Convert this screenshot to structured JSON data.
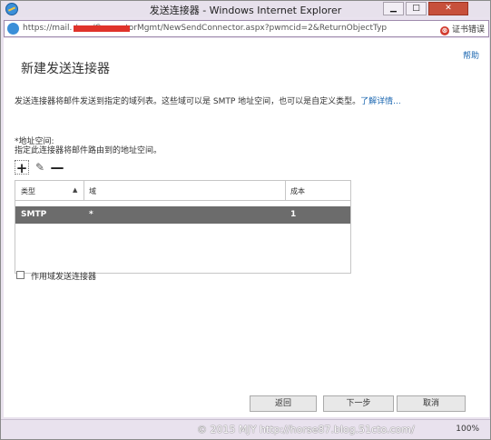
{
  "window": {
    "title": "发送连接器 - Windows Internet Explorer",
    "minimize": "▁",
    "maximize": "□",
    "close": "✕"
  },
  "address_bar": {
    "url": "https://mail.                 /ecp/ConnectorMgmt/NewSendConnector.aspx?pwmcid=2&ReturnObjectTyp",
    "cert_error_icon": "⊗",
    "cert_error": "证书错误"
  },
  "page": {
    "help": "帮助",
    "title": "新建发送连接器",
    "description": "发送连接器将邮件发送到指定的域列表。这些域可以是 SMTP 地址空间，也可以是自定义类型。",
    "learn_more": "了解详情..."
  },
  "address_space": {
    "label": "*地址空间:",
    "sublabel": "指定此连接器将邮件路由到的地址空间。",
    "toolbar": {
      "add": "+",
      "edit": "✎",
      "remove": "—"
    },
    "columns": [
      "类型",
      "域",
      "成本"
    ],
    "sort_indicator": "▲",
    "rows": [
      {
        "type": "SMTP",
        "domain": "*",
        "cost": "1"
      }
    ]
  },
  "scoped": {
    "label": "作用域发送连接器"
  },
  "buttons": {
    "back": "返回",
    "next": "下一步",
    "cancel": "取消"
  },
  "status_bar": {
    "watermark": "© 2015 MJY http://horse87.blog.51cto.com/",
    "zoom": "100%"
  },
  "colors": {
    "accent_link": "#1a66b0",
    "selected_row": "#6c6c6c",
    "redaction": "#e0332b",
    "window_chrome": "#e9e2ee"
  }
}
